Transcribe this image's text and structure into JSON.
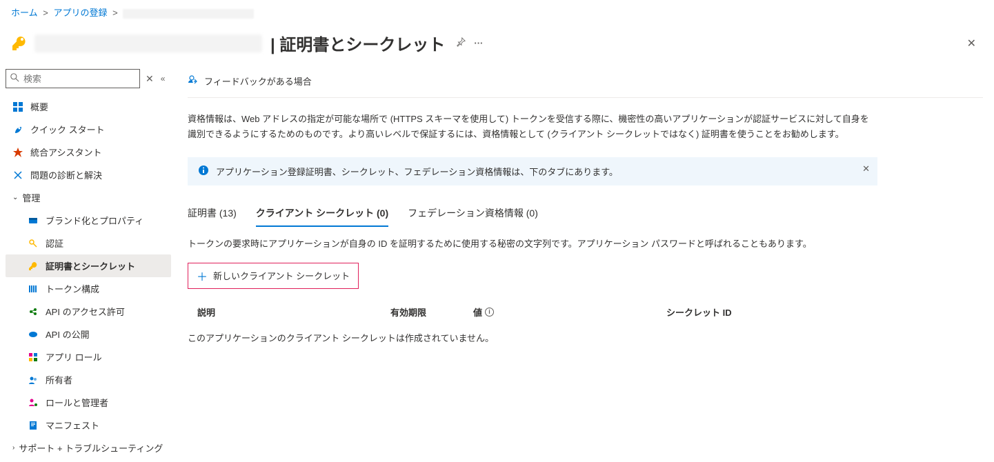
{
  "breadcrumb": {
    "home": "ホーム",
    "apps": "アプリの登録"
  },
  "header": {
    "title": "| 証明書とシークレット"
  },
  "search": {
    "placeholder": "検索"
  },
  "nav": {
    "overview": "概要",
    "quickstart": "クイック スタート",
    "integration": "統合アシスタント",
    "diagnose": "問題の診断と解決",
    "manage_group": "管理",
    "branding": "ブランド化とプロパティ",
    "auth": "認証",
    "certs": "証明書とシークレット",
    "token": "トークン構成",
    "api_perm": "API のアクセス許可",
    "api_expose": "API の公開",
    "app_roles": "アプリ ロール",
    "owners": "所有者",
    "roles_admins": "ロールと管理者",
    "manifest": "マニフェスト",
    "support_group": "サポート + トラブルシューティング"
  },
  "main": {
    "feedback": "フィードバックがある場合",
    "description": "資格情報は、Web アドレスの指定が可能な場所で (HTTPS スキーマを使用して) トークンを受信する際に、機密性の高いアプリケーションが認証サービスに対して自身を識別できるようにするためのものです。より高いレベルで保証するには、資格情報として (クライアント シークレットではなく) 証明書を使うことをお勧めします。",
    "info": "アプリケーション登録証明書、シークレット、フェデレーション資格情報は、下のタブにあります。",
    "tabs": {
      "certs": "証明書 (13)",
      "secrets": "クライアント シークレット (0)",
      "federation": "フェデレーション資格情報 (0)"
    },
    "tab_desc": "トークンの要求時にアプリケーションが自身の ID を証明するために使用する秘密の文字列です。アプリケーション パスワードと呼ばれることもあります。",
    "new_btn": "新しいクライアント シークレット",
    "columns": {
      "desc": "説明",
      "expires": "有効期限",
      "value": "値",
      "id": "シークレット ID"
    },
    "empty": "このアプリケーションのクライアント シークレットは作成されていません。"
  }
}
